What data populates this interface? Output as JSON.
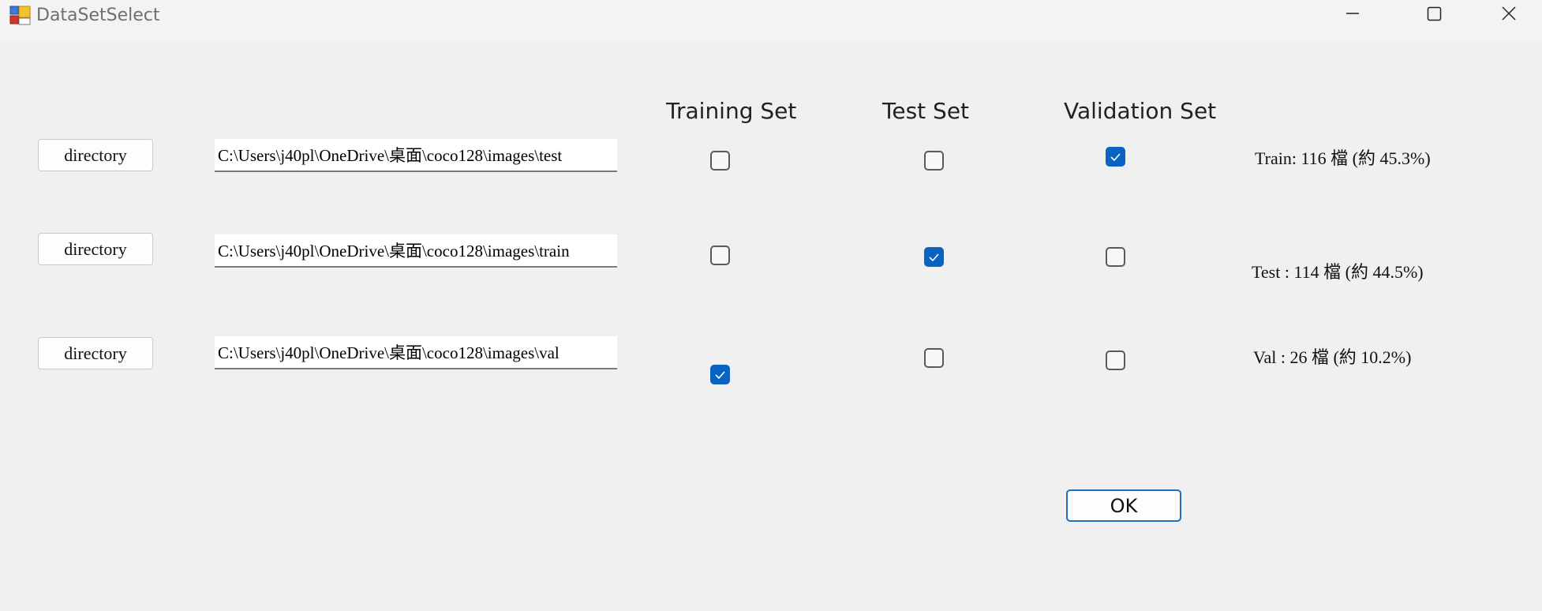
{
  "window": {
    "title": "DataSetSelect",
    "icon": "winforms-app-icon"
  },
  "title_buttons": {
    "minimize": "minimize-icon",
    "maximize": "maximize-icon",
    "close": "close-icon"
  },
  "headers": {
    "training": "Training Set",
    "test": "Test Set",
    "validation": "Validation Set"
  },
  "rows": [
    {
      "button_label": "directory",
      "path": "C:\\Users\\j40pl\\OneDrive\\桌面\\coco128\\images\\test",
      "training": false,
      "test": false,
      "validation": true,
      "count": "Train: 116 檔 (約 45.3%)"
    },
    {
      "button_label": "directory",
      "path": "C:\\Users\\j40pl\\OneDrive\\桌面\\coco128\\images\\train",
      "training": false,
      "test": true,
      "validation": false,
      "count": "Test : 114 檔 (約 44.5%)"
    },
    {
      "button_label": "directory",
      "path": "C:\\Users\\j40pl\\OneDrive\\桌面\\coco128\\images\\val",
      "training": true,
      "test": false,
      "validation": false,
      "count": "Val : 26 檔 (約 10.2%)"
    }
  ],
  "ok_label": "OK",
  "colors": {
    "accent": "#0a63c2",
    "background": "#f0f0f0"
  }
}
